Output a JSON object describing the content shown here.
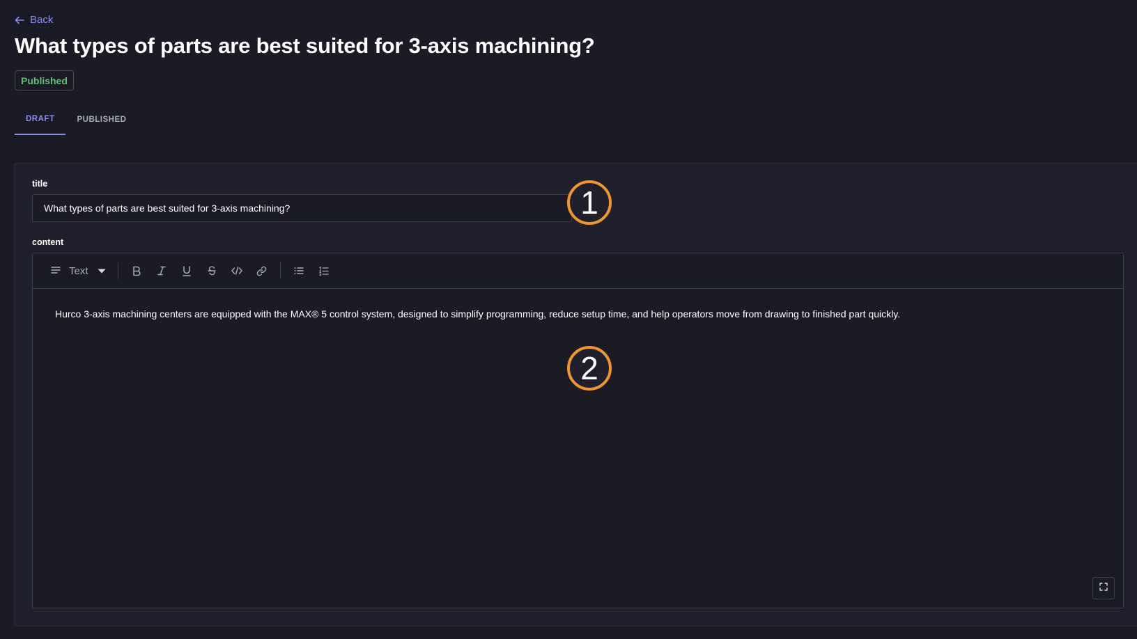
{
  "nav": {
    "back_label": "Back"
  },
  "page": {
    "title": "What types of parts are best suited for 3-axis machining?",
    "status": "Published"
  },
  "tabs": [
    {
      "label": "DRAFT",
      "active": true
    },
    {
      "label": "PUBLISHED",
      "active": false
    }
  ],
  "form": {
    "title_label": "title",
    "title_value": "What types of parts are best suited for 3-axis machining?",
    "content_label": "content",
    "content_text": "Hurco 3-axis machining centers are equipped with the MAX® 5 control system, designed to simplify programming, reduce setup time, and help operators move from drawing to finished part quickly."
  },
  "toolbar": {
    "block_style": "Text",
    "buttons": [
      "bold-icon",
      "italic-icon",
      "underline-icon",
      "strikethrough-icon",
      "code-icon",
      "link-icon",
      "bullet-list-icon",
      "numbered-list-icon"
    ]
  },
  "markers": [
    "1",
    "2"
  ],
  "colors": {
    "background": "#1b1b26",
    "panel": "#20202d",
    "accent": "#8b8cf0",
    "published_green": "#5fbf7a",
    "marker_orange": "#f0962b"
  }
}
